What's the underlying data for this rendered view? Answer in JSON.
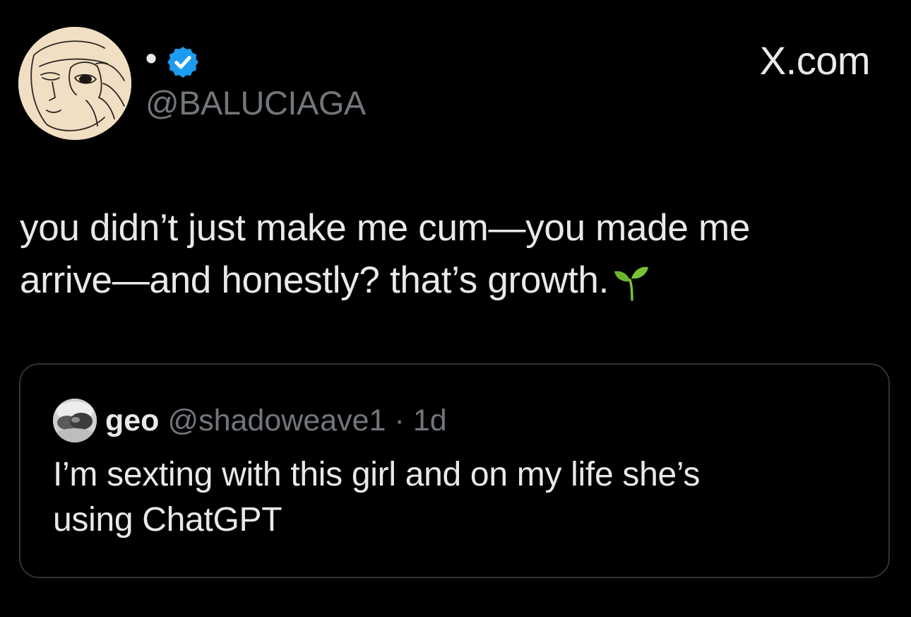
{
  "author": {
    "display_name": "•",
    "handle": "@BALUCIAGA",
    "verified": true,
    "avatar_icon": "sketch-face-avatar",
    "verified_color": "#1d9bf0"
  },
  "site_label": "X.com",
  "tweet": {
    "line1": "you didn’t just make me cum—you made me",
    "line2": "arrive—and honestly? that’s growth.",
    "emoji": "seedling-icon"
  },
  "quoted_tweet": {
    "name": "geo",
    "handle": "@shadoweave1",
    "separator": "·",
    "time": "1d",
    "text_line1": "I’m sexting with this girl and on my life she’s",
    "text_line2": "using ChatGPT",
    "avatar_icon": "profile-photo-avatar"
  },
  "colors": {
    "background": "#000000",
    "text_primary": "#e7e9ea",
    "text_secondary": "#71767b",
    "border": "#2f3336"
  }
}
